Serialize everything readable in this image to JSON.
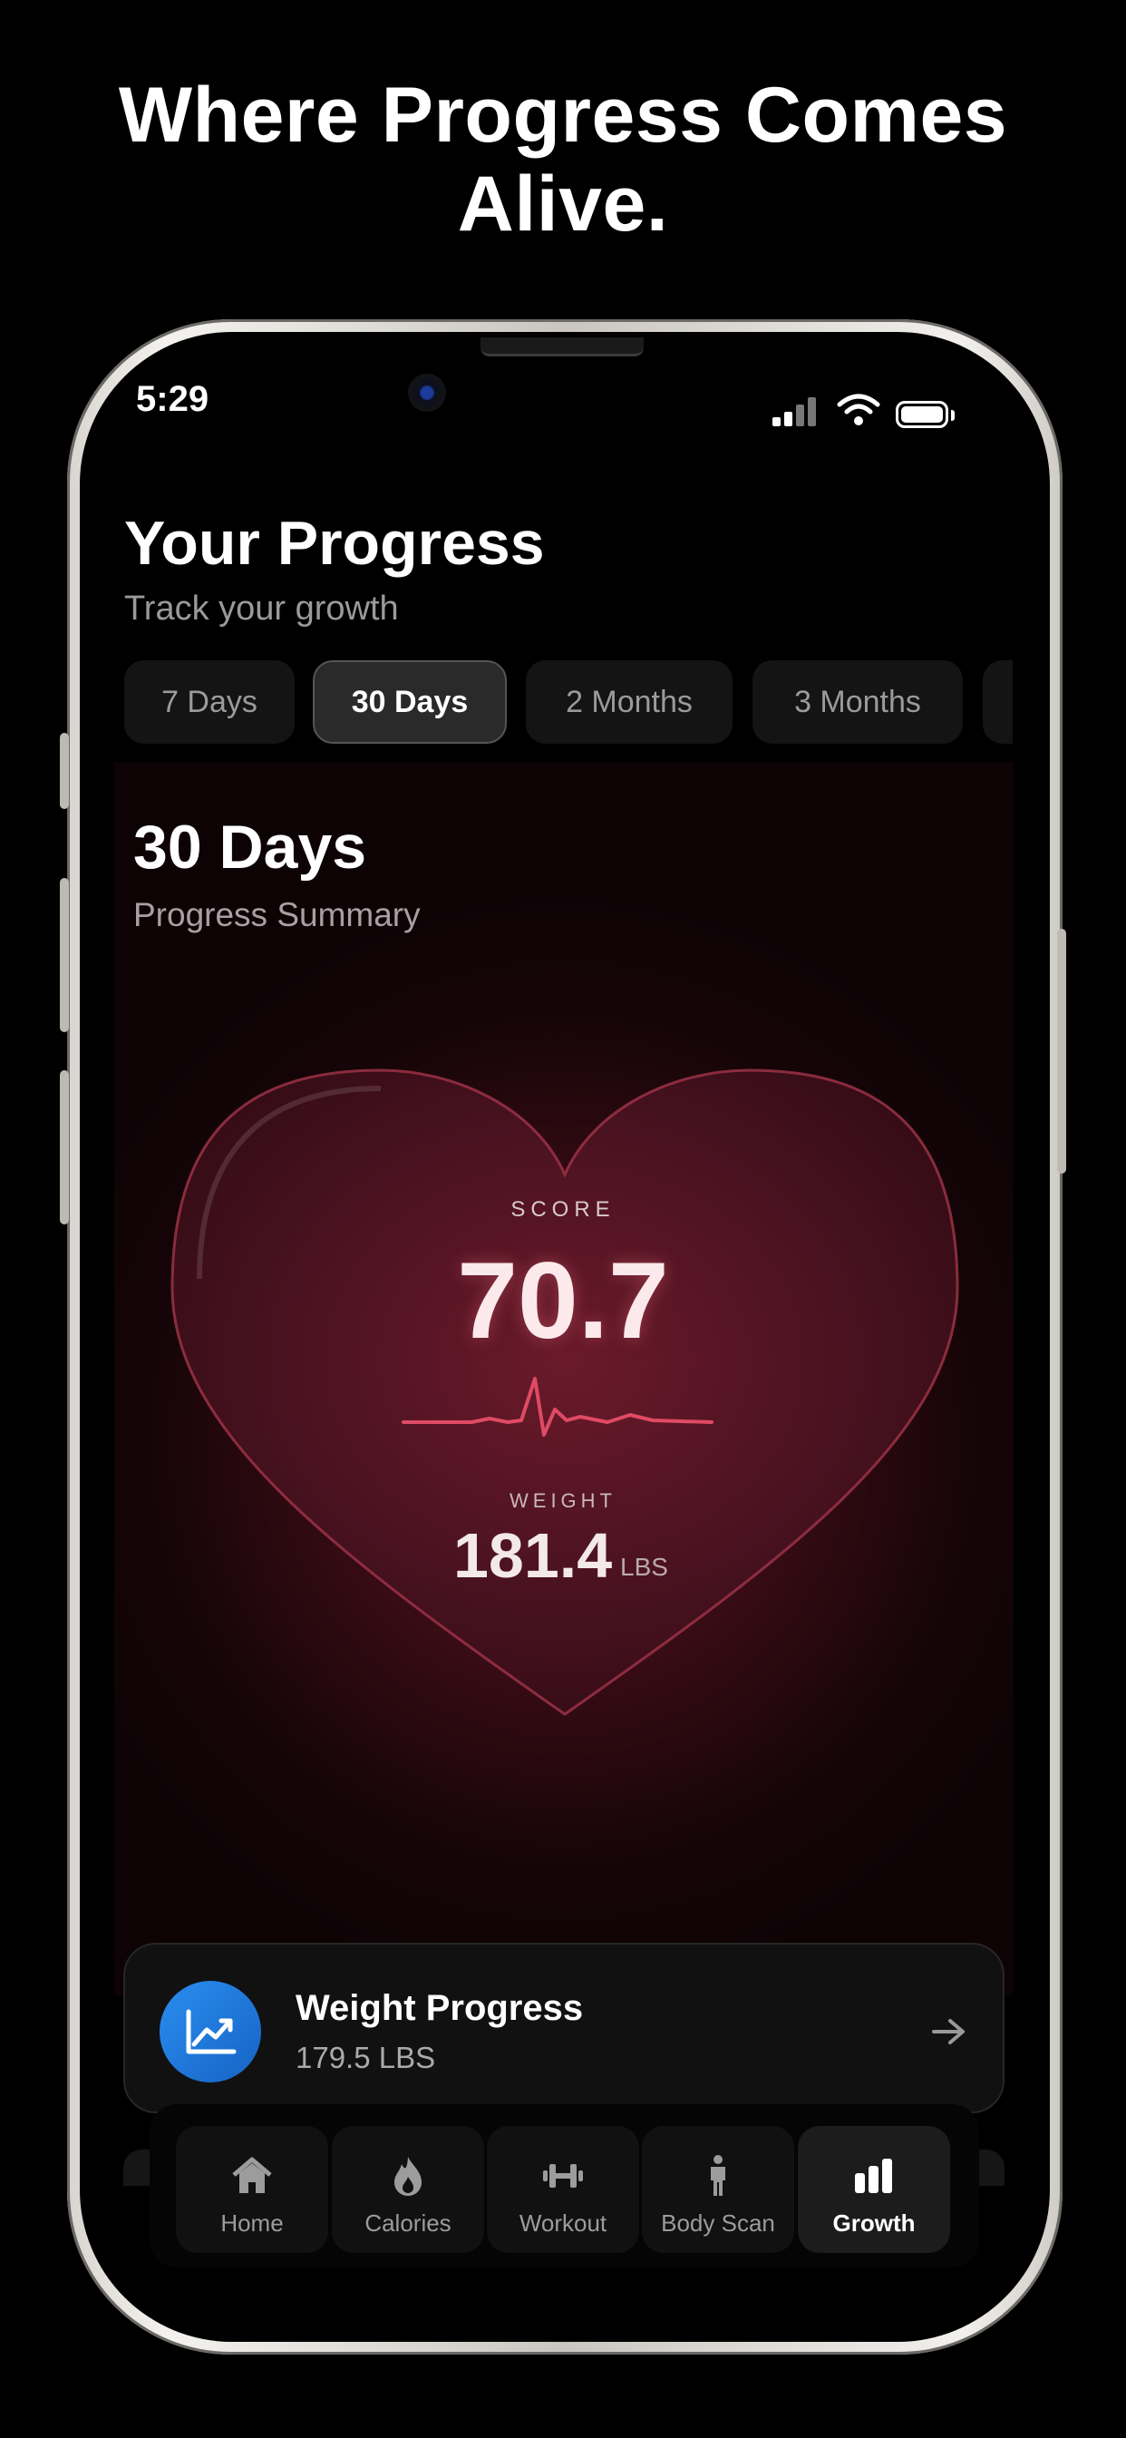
{
  "headline": {
    "line1": "Where Progress Comes",
    "line2": "Alive."
  },
  "status_bar": {
    "time": "5:29"
  },
  "header": {
    "title": "Your Progress",
    "subtitle": "Track your growth"
  },
  "tabs": [
    {
      "label": "7 Days",
      "active": false
    },
    {
      "label": "30 Days",
      "active": true
    },
    {
      "label": "2 Months",
      "active": false
    },
    {
      "label": "3 Months",
      "active": false
    }
  ],
  "summary": {
    "title": "30 Days",
    "subtitle": "Progress Summary",
    "score_label": "SCORE",
    "score": "70.7",
    "weight_label": "WEIGHT",
    "weight": "181.4",
    "weight_unit": "LBS"
  },
  "weight_progress": {
    "title": "Weight Progress",
    "value": "179.5 LBS"
  },
  "nav": [
    {
      "label": "Home",
      "icon": "home-icon"
    },
    {
      "label": "Calories",
      "icon": "flame-icon"
    },
    {
      "label": "Workout",
      "icon": "dumbbell-icon"
    },
    {
      "label": "Body Scan",
      "icon": "body-icon"
    },
    {
      "label": "Growth",
      "icon": "bar-chart-icon",
      "active": true
    }
  ],
  "colors": {
    "accent_red": "#e04a64",
    "accent_blue": "#2a8ef0",
    "background": "#000000"
  }
}
